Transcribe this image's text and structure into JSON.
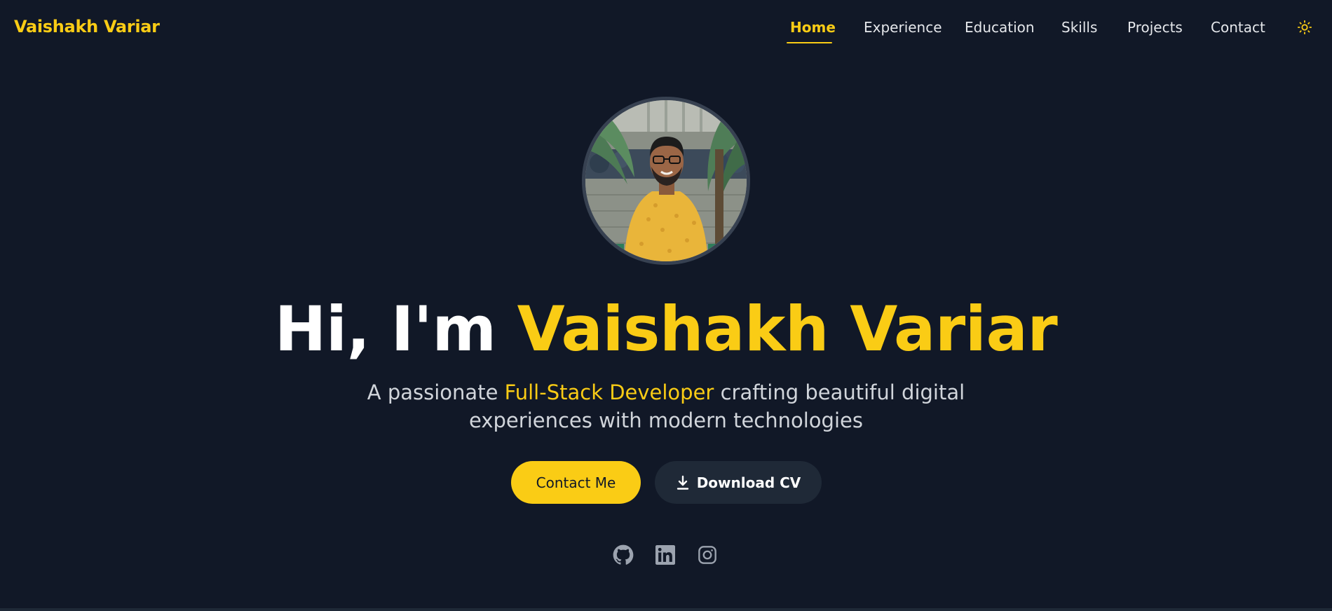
{
  "brand": "Vaishakh Variar",
  "nav": {
    "items": [
      {
        "label": "Home",
        "active": true
      },
      {
        "label": "Experience",
        "active": false
      },
      {
        "label": "Education",
        "active": false
      },
      {
        "label": "Skills",
        "active": false
      },
      {
        "label": "Projects",
        "active": false
      },
      {
        "label": "Contact",
        "active": false
      }
    ],
    "theme_toggle_icon": "sun-icon"
  },
  "hero": {
    "greeting": "Hi, I'm ",
    "name": "Vaishakh Variar",
    "subtitle_pre": "A passionate ",
    "subtitle_highlight": "Full-Stack Developer",
    "subtitle_post": " crafting beautiful digital experiences with modern technologies",
    "avatar_icon": "profile-photo"
  },
  "buttons": {
    "contact_label": "Contact Me",
    "download_label": "Download CV",
    "download_icon": "download-icon"
  },
  "social": {
    "icons": [
      "github-icon",
      "linkedin-icon",
      "instagram-icon"
    ]
  },
  "colors": {
    "background": "#111827",
    "accent": "#facc15",
    "text": "#e5e7eb",
    "secondary_button": "#1f2937"
  }
}
